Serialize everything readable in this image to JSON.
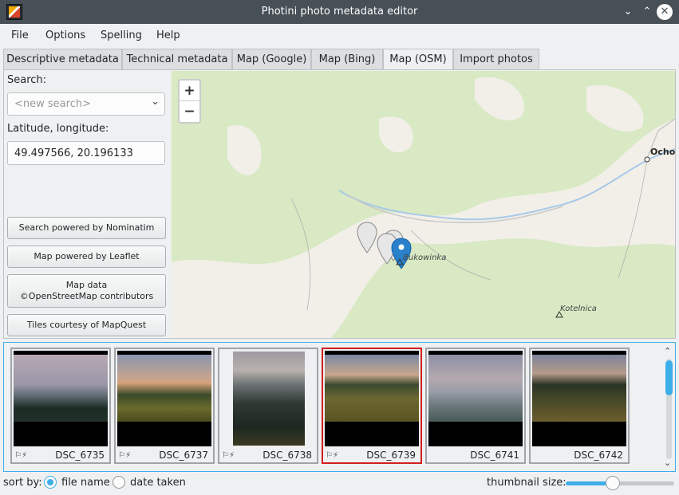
{
  "window": {
    "title": "Photini photo metadata editor",
    "minimize": "⌄",
    "maximize": "⌃",
    "close": "✕"
  },
  "menu": [
    "File",
    "Options",
    "Spelling",
    "Help"
  ],
  "tabs": [
    {
      "label": "Descriptive metadata",
      "active": false
    },
    {
      "label": "Technical metadata",
      "active": false
    },
    {
      "label": "Map (Google)",
      "active": false
    },
    {
      "label": "Map (Bing)",
      "active": false
    },
    {
      "label": "Map (OSM)",
      "active": true
    },
    {
      "label": "Import photos",
      "active": false
    }
  ],
  "sidebar": {
    "search_label": "Search:",
    "search_placeholder": "<new search>",
    "latlon_label": "Latitude, longitude:",
    "latlon_value": "49.497566, 20.196133",
    "buttons": [
      "Search powered by Nominatim",
      "Map powered by Leaflet",
      "Map data\n©OpenStreetMap contributors",
      "Tiles courtesy of MapQuest"
    ]
  },
  "map": {
    "zoom_in": "+",
    "zoom_out": "−",
    "labels": {
      "town": "Ocho",
      "peak1": "Bukowinka",
      "peak2": "Kotelnica"
    }
  },
  "thumbnails": [
    {
      "name": "DSC_6735",
      "selected": false,
      "flags": "⚐⚡"
    },
    {
      "name": "DSC_6737",
      "selected": false,
      "flags": "⚐⚡"
    },
    {
      "name": "DSC_6738",
      "selected": false,
      "flags": "⚐⚡"
    },
    {
      "name": "DSC_6739",
      "selected": true,
      "flags": "⚐⚡"
    },
    {
      "name": "DSC_6741",
      "selected": false,
      "flags": ""
    },
    {
      "name": "DSC_6742",
      "selected": false,
      "flags": ""
    }
  ],
  "bottom": {
    "sort_by": "sort by:",
    "file_name": "file name",
    "date_taken": "date taken",
    "sort_selected": "file name",
    "thumb_size_label": "thumbnail size:",
    "thumb_size_fraction": 0.42
  },
  "colors": {
    "accent": "#3daee9",
    "selected_border": "#d21f1f",
    "marker": "#2a81cb"
  }
}
